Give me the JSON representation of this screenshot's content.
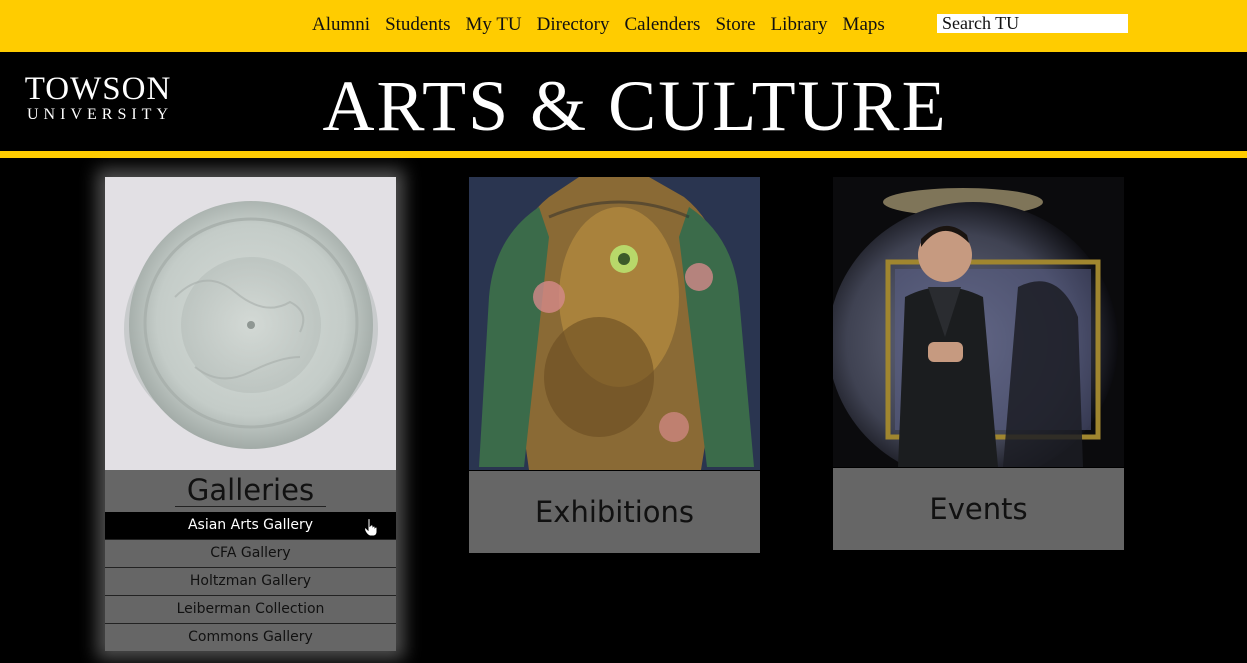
{
  "topnav": {
    "links": [
      "Alumni",
      "Students",
      "My TU",
      "Directory",
      "Calenders",
      "Store",
      "Library",
      "Maps"
    ],
    "search_placeholder": "Search TU"
  },
  "header": {
    "logo_top": "TOWSON",
    "logo_bottom": "UNIVERSITY",
    "site_title": "ARTS & CULTURE"
  },
  "cards": {
    "galleries": {
      "label": "Galleries",
      "items": [
        "Asian Arts Gallery",
        "CFA Gallery",
        "Holtzman Gallery",
        "Leiberman Collection",
        "Commons Gallery"
      ],
      "active_item": "Asian Arts Gallery"
    },
    "exhibitions": {
      "label": "Exhibitions"
    },
    "events": {
      "label": "Events"
    }
  },
  "colors": {
    "brand_gold": "#ffcc00",
    "background": "#000000",
    "label_gray": "#666666"
  },
  "icons": {
    "cursor": "hand-pointer-icon"
  }
}
